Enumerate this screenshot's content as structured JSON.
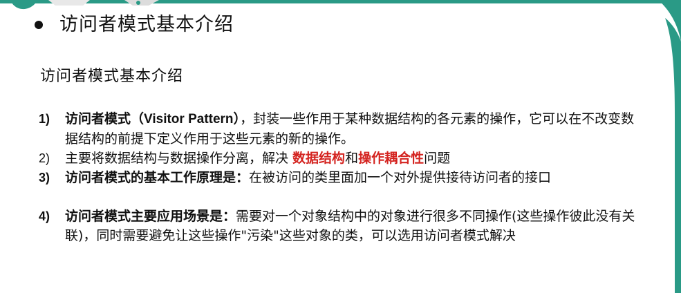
{
  "slide": {
    "main_title": "访问者模式基本介绍",
    "section_heading": "访问者模式基本介绍",
    "items": [
      {
        "number": "1)",
        "bold_lead": "访问者模式（",
        "bold_latin": "Visitor Pattern",
        "bold_close": "）",
        "rest": "，封装一些作用于某种数据结构的各元素的操作，它可以在不改变数据结构的前提下定义作用于这些元素的新的操作。"
      },
      {
        "number": "2)",
        "text_before": "主要将数据结构与数据操作分离，解决 ",
        "highlight_1": "数据结构",
        "joiner": "和",
        "highlight_2": "操作耦合性",
        "text_after": "问题"
      },
      {
        "number": "3)",
        "bold_lead": "访问者模式的基本工作原理是：",
        "rest": "在被访问的类里面加一个对外提供接待访问者的接口"
      },
      {
        "number": "4)",
        "bold_lead": "访问者模式主要应用场景是：",
        "rest": "需要对一个对象结构中的对象进行很多不同操作(这些操作彼此没有关联)，同时需要避免让这些操作\"污染\"这些对象的类，可以选用访问者模式解决"
      }
    ]
  },
  "colors": {
    "accent_teal": "#2a9a86",
    "highlight_red": "#d42420",
    "text": "#111111"
  }
}
